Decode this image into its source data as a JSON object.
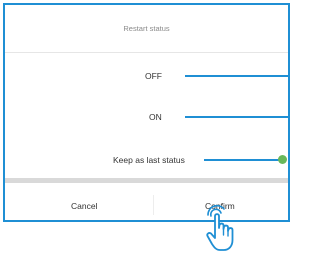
{
  "dialog": {
    "title": "Restart status",
    "options": [
      {
        "label": "OFF"
      },
      {
        "label": "ON"
      },
      {
        "label": "Keep as last status",
        "selected": true
      }
    ],
    "buttons": {
      "cancel_label": "Cancel",
      "confirm_label": "Confirm"
    }
  },
  "colors": {
    "accent": "#1f8fd4",
    "selected_indicator": "#69b85a",
    "text": "#333333",
    "muted_text": "#8a8a8a"
  },
  "icons": {
    "pointer": "hand-pointer-icon",
    "selected": "radio-selected-icon"
  }
}
